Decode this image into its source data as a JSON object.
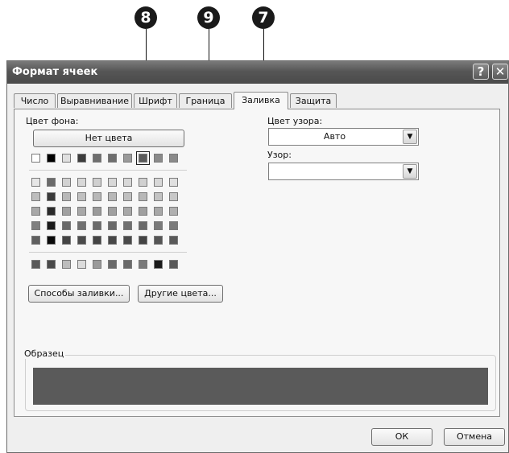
{
  "callouts": [
    "8",
    "9",
    "7"
  ],
  "window": {
    "title": "Формат ячеек",
    "help": "?",
    "close": "✕"
  },
  "tabs": [
    {
      "label": "Число"
    },
    {
      "label": "Выравнивание"
    },
    {
      "label": "Шрифт"
    },
    {
      "label": "Граница"
    },
    {
      "label": "Заливка",
      "active": true
    },
    {
      "label": "Защита"
    }
  ],
  "fill": {
    "bg_label": "Цвет фона:",
    "no_color_button": "Нет цвета",
    "pattern_color_label": "Цвет узора:",
    "pattern_color_value": "Авто",
    "pattern_label": "Узор:",
    "pattern_value": "",
    "fill_effects_button": "Способы заливки...",
    "more_colors_button": "Другие цвета...",
    "sample_label": "Образец",
    "sample_color": "#5a5a5a",
    "palette_row1": [
      "#ffffff",
      "#000000",
      "#e0e0e0",
      "#3c3c3c",
      "#6e6e6e",
      "#6e6e6e",
      "#9a9a9a",
      "#5a5a5a",
      "#8a8a8a",
      "#8a8a8a"
    ],
    "palette_grid": [
      [
        "#e6e6e6",
        "#6a6a6a",
        "#d2d2d2",
        "#d8d8d8",
        "#d0d0d0",
        "#d8d8d8",
        "#d8d8d8",
        "#d0d0d0",
        "#d8d8d8",
        "#e0e0e0"
      ],
      [
        "#bdbdbd",
        "#3a3a3a",
        "#b8b8b8",
        "#c0c0c0",
        "#b8b8b8",
        "#b8b8b8",
        "#c0c0c0",
        "#b8b8b8",
        "#c4c4c4",
        "#c8c8c8"
      ],
      [
        "#a8a8a8",
        "#2a2a2a",
        "#a0a0a0",
        "#a8a8a8",
        "#9a9a9a",
        "#a0a0a0",
        "#a8a8a8",
        "#a0a0a0",
        "#a8a8a8",
        "#b0b0b0"
      ],
      [
        "#808080",
        "#1a1a1a",
        "#6a6a6a",
        "#707070",
        "#6a6a6a",
        "#6a6a6a",
        "#707070",
        "#6a6a6a",
        "#7a7a7a",
        "#7a7a7a"
      ],
      [
        "#606060",
        "#0a0a0a",
        "#444444",
        "#4a4a4a",
        "#444444",
        "#484848",
        "#4a4a4a",
        "#444444",
        "#555555",
        "#5a5a5a"
      ]
    ],
    "palette_last": [
      "#5a5a5a",
      "#4a4a4a",
      "#bdbdbd",
      "#dcdcdc",
      "#9a9a9a",
      "#6a6a6a",
      "#6a6a6a",
      "#7a7a7a",
      "#1a1a1a",
      "#5a5a5a"
    ],
    "selected_swatch_index": 7
  },
  "footer": {
    "ok": "ОК",
    "cancel": "Отмена"
  }
}
